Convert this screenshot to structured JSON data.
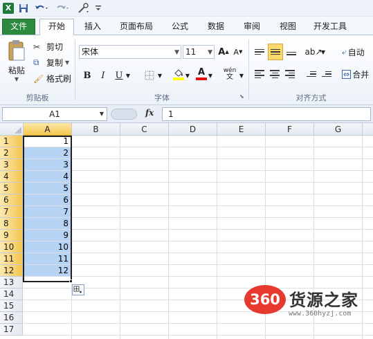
{
  "quick_access": {
    "logo": "X",
    "save_icon": "save-icon",
    "undo_icon": "undo-icon",
    "redo_icon": "redo-icon",
    "customize_icon": "customize-icon"
  },
  "tabs": [
    {
      "label": "文件"
    },
    {
      "label": "开始"
    },
    {
      "label": "插入"
    },
    {
      "label": "页面布局"
    },
    {
      "label": "公式"
    },
    {
      "label": "数据"
    },
    {
      "label": "审阅"
    },
    {
      "label": "视图"
    },
    {
      "label": "开发工具"
    }
  ],
  "ribbon": {
    "clipboard": {
      "paste": "粘贴",
      "cut": "剪切",
      "copy": "复制",
      "format_painter": "格式刷",
      "label": "剪贴板"
    },
    "font": {
      "name": "宋体",
      "size": "11",
      "bold": "B",
      "italic": "I",
      "underline": "U",
      "font_color_letter": "A",
      "label": "字体",
      "wen": "wén"
    },
    "alignment": {
      "wrap": "自动",
      "merge": "合并",
      "label": "对齐方式"
    }
  },
  "formula_bar": {
    "name_box": "A1",
    "fx": "fx",
    "value": "1"
  },
  "sheet": {
    "columns": [
      "A",
      "B",
      "C",
      "D",
      "E",
      "F",
      "G"
    ],
    "rows": [
      "1",
      "2",
      "3",
      "4",
      "5",
      "6",
      "7",
      "8",
      "9",
      "10",
      "11",
      "12",
      "13",
      "14",
      "15",
      "16",
      "17"
    ],
    "a_values": [
      "1",
      "2",
      "3",
      "4",
      "5",
      "6",
      "7",
      "8",
      "9",
      "10",
      "11",
      "12"
    ]
  },
  "watermark": {
    "badge": "360",
    "text": "货源之家",
    "url": "www.360hyzj.com"
  },
  "colors": {
    "file_tab": "#2c8a3e",
    "selection_fill": "#b6d3f3",
    "header_selected": "#f4c64f",
    "watermark_red": "#e63a2e"
  }
}
